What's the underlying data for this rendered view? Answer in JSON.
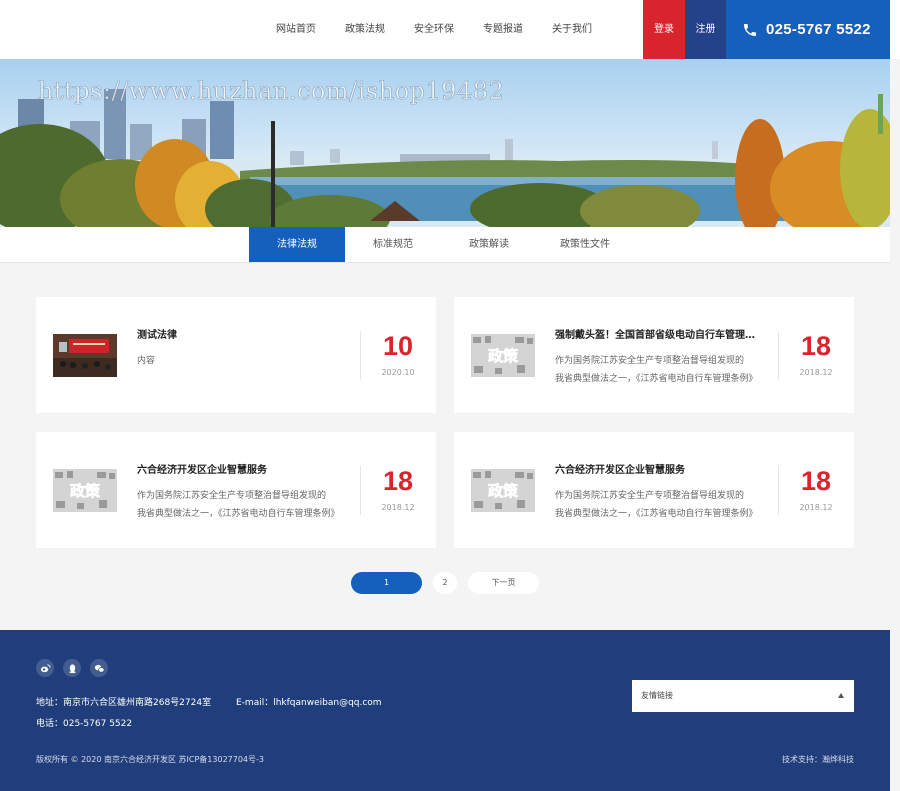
{
  "header": {
    "nav": [
      "网站首页",
      "政策法规",
      "安全环保",
      "专题报道",
      "关于我们"
    ],
    "login_label": "登录",
    "register_label": "注册",
    "phone_icon": "phone-icon",
    "phone": "025-5767 5522"
  },
  "banner": {
    "watermark": "https://www.huzhan.com/ishop19482"
  },
  "subnav": {
    "tabs": [
      "法律法规",
      "标准规范",
      "政策解读",
      "政策性文件"
    ],
    "active": "法律法规"
  },
  "articles": [
    {
      "title": "测试法律",
      "desc": [
        "内容"
      ],
      "day": "10",
      "ym": "2020.10",
      "thumb": "meeting-photo"
    },
    {
      "title": "强制戴头盔！全国首部省级电动自行车管理条例",
      "desc": [
        "作为国务院江苏安全生产专项整治督导组发现的",
        "我省典型做法之一，《江苏省电动自行车管理条例》"
      ],
      "day": "18",
      "ym": "2018.12",
      "thumb": "policy-graphic"
    },
    {
      "title": "六合经济开发区企业智慧服务",
      "desc": [
        "作为国务院江苏安全生产专项整治督导组发现的",
        "我省典型做法之一，《江苏省电动自行车管理条例》"
      ],
      "day": "18",
      "ym": "2018.12",
      "thumb": "policy-graphic"
    },
    {
      "title": "六合经济开发区企业智慧服务",
      "desc": [
        "作为国务院江苏安全生产专项整治督导组发现的",
        "我省典型做法之一，《江苏省电动自行车管理条例》"
      ],
      "day": "18",
      "ym": "2018.12",
      "thumb": "policy-graphic"
    }
  ],
  "thumb_text": "政策",
  "pagination": {
    "pages": [
      "1",
      "2"
    ],
    "current": "1",
    "next": "下一页"
  },
  "footer": {
    "social_icons": [
      "weibo-icon",
      "qq-icon",
      "wechat-icon"
    ],
    "address": "地址：南京市六合区雄州南路268号2724室",
    "email": "E-mail：lhkfqanweiban@qq.com",
    "tel": "电话：025-5767 5522",
    "links_label": "友情链接",
    "copyright": "版权所有 © 2020 南京六合经济开发区 苏ICP备13027704号-3",
    "tech": "技术支持：瀚烨科技"
  },
  "colors": {
    "brand_blue": "#1560bd",
    "accent_red": "#d9232d",
    "footer_blue": "#203e7c"
  }
}
